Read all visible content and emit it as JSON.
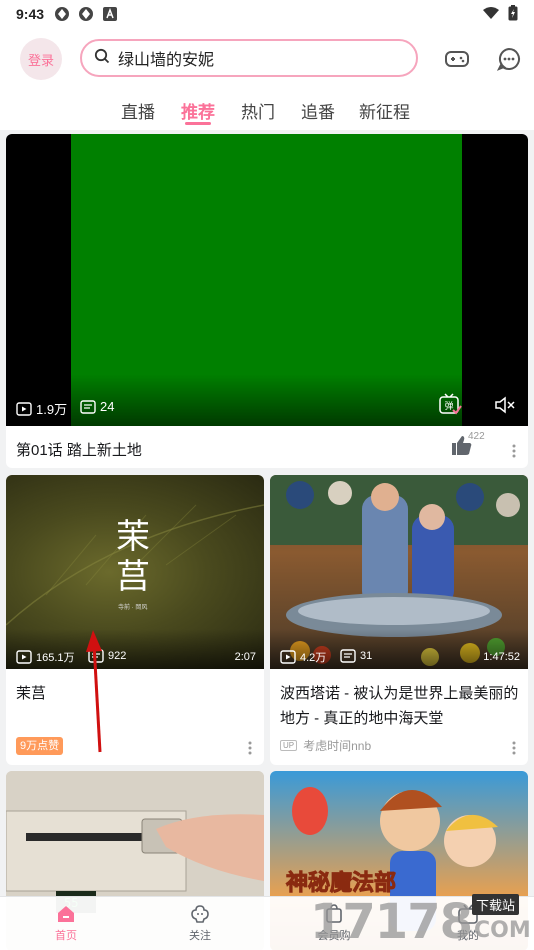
{
  "status_bar": {
    "time": "9:43"
  },
  "header": {
    "login_label": "登录",
    "search_query": "绿山墙的安妮"
  },
  "tabs": [
    {
      "label": "直播",
      "active": false
    },
    {
      "label": "推荐",
      "active": true
    },
    {
      "label": "热门",
      "active": false
    },
    {
      "label": "追番",
      "active": false
    },
    {
      "label": "新征程",
      "active": false
    }
  ],
  "featured": {
    "views": "1.9万",
    "danmaku": "24",
    "title": "第01话 踏上新土地",
    "likes": "422",
    "danmaku_toggle": "弹"
  },
  "cards": [
    {
      "thumb_text_big_1": "茉",
      "thumb_text_big_2": "莒",
      "thumb_caption": "寺前 · 岡风",
      "views": "165.1万",
      "danmaku": "922",
      "duration": "2:07",
      "title": "茉莒",
      "badge": "9万点赞"
    },
    {
      "views": "4.2万",
      "danmaku": "31",
      "duration": "1:47:52",
      "title": "波西塔诺 - 被认为是世界上最美丽的地方 - 真正的地中海天堂",
      "up_tag": "UP",
      "uploader": "考虑时间nnb"
    },
    {
      "overlay_title": "神秘魔法部"
    }
  ],
  "bottom_nav": [
    {
      "label": "首页",
      "active": true
    },
    {
      "label": "关注",
      "active": false
    },
    {
      "label": "会员购",
      "active": false
    },
    {
      "label": "我的",
      "active": false
    }
  ],
  "watermark": {
    "brand": "17178",
    "label": "下载站",
    "suffix": "COM"
  },
  "colors": {
    "accent": "#fb7299",
    "badge": "#ff9a5a",
    "video_green": "#008000"
  }
}
